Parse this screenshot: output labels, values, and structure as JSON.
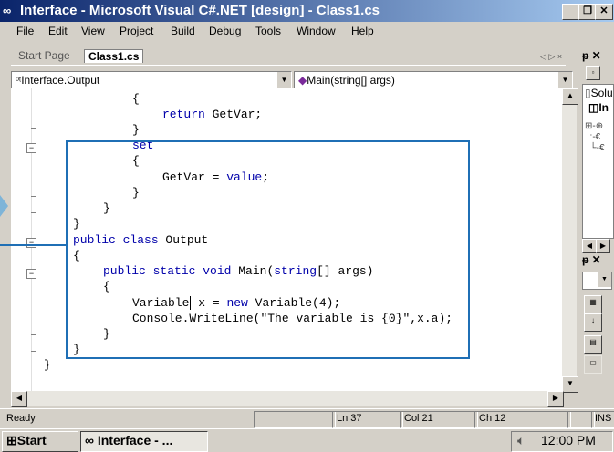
{
  "window": {
    "title": "Interface - Microsoft Visual C#.NET [design] - Class1.cs"
  },
  "menu": [
    "File",
    "Edit",
    "View",
    "Project",
    "Build",
    "Debug",
    "Tools",
    "Window",
    "Help"
  ],
  "tabs": {
    "start": "Start Page",
    "active": "Class1.cs",
    "nav": "◁ ▷ ×"
  },
  "combos": {
    "type_value": "Interface.Output",
    "member_value": "Main(string[] args)"
  },
  "code_lines": [
    "{",
    "return GetVar;",
    "}",
    "set",
    "{",
    "GetVar = value;",
    "}",
    "}",
    "}",
    "public class Output",
    "{",
    "public static void Main(string[] args)",
    "{",
    "Variable x = new Variable(4);",
    "Console.WriteLine(\"The variable is {0}\",x.a);",
    "}",
    "}",
    "}"
  ],
  "solution": {
    "label": "Solu",
    "item": "In"
  },
  "status": {
    "ready": "Ready",
    "ln": "Ln 37",
    "col": "Col 21",
    "ch": "Ch 12",
    "ins": "INS"
  },
  "taskbar": {
    "start": "Start",
    "task": "Interface - ...",
    "clock": "12:00 PM"
  },
  "colors": {
    "titlebar": "#0a246a",
    "highlight": "#1f6fb5",
    "keyword": "#0000aa"
  }
}
